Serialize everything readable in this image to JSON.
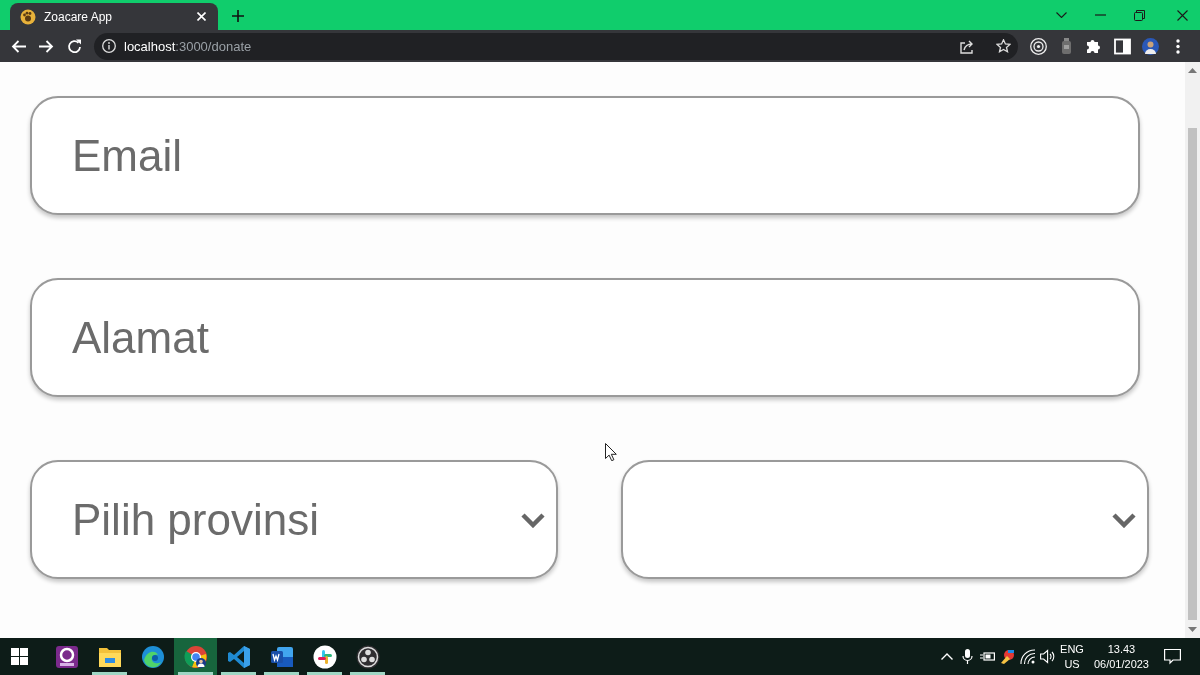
{
  "browser": {
    "tabs": [
      {
        "title": "Zoacare App",
        "selected": true
      }
    ],
    "url": {
      "host": "localhost",
      "path": ":3000/donate"
    }
  },
  "form": {
    "fields": [
      {
        "kind": "text",
        "placeholder": "Email"
      },
      {
        "kind": "text",
        "placeholder": "Alamat"
      }
    ],
    "selects": [
      {
        "kind": "dropdown",
        "value": "Pilih provinsi"
      },
      {
        "kind": "dropdown"
      }
    ]
  },
  "taskbar": {
    "apps": [
      {
        "kind": "ebook",
        "running": false,
        "selected": false
      },
      {
        "kind": "explorer",
        "running": true,
        "selected": false
      },
      {
        "kind": "edge",
        "running": false,
        "selected": false
      },
      {
        "kind": "chrome",
        "running": true,
        "selected": true
      },
      {
        "kind": "vscode",
        "running": true,
        "selected": false
      },
      {
        "kind": "word",
        "running": true,
        "selected": false
      },
      {
        "kind": "slack",
        "running": true,
        "selected": false
      },
      {
        "kind": "obs",
        "running": true,
        "selected": false
      }
    ],
    "language": "ENG",
    "region": "US",
    "time": "13.43",
    "date": "06/01/2023"
  }
}
